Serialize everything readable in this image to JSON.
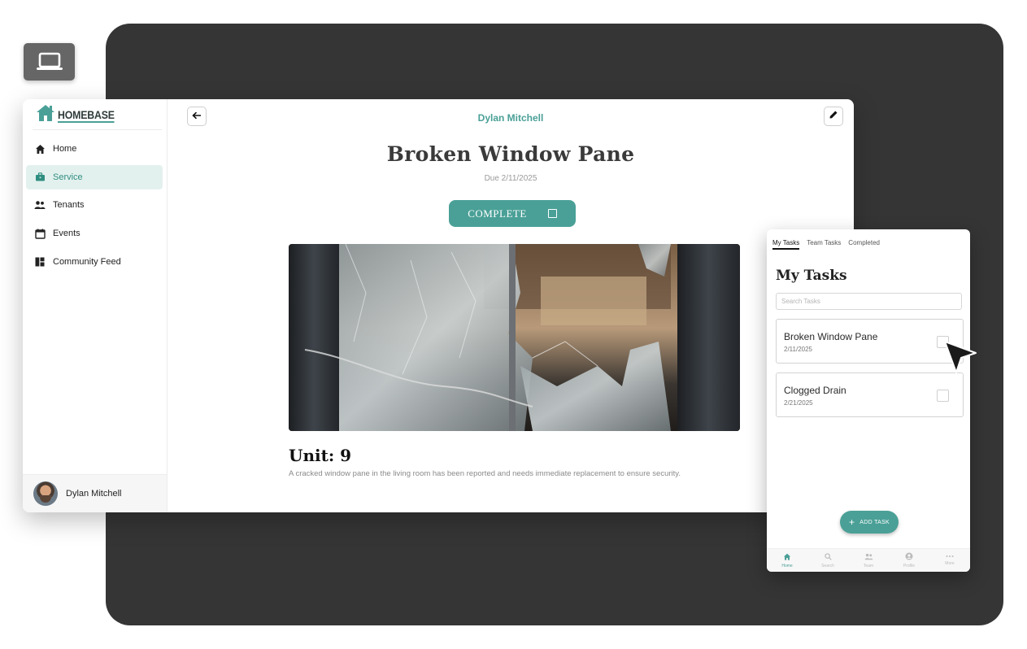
{
  "colors": {
    "accent": "#4aa097",
    "dark_panel": "#353535",
    "badge": "#666666"
  },
  "badges": {
    "desktop_icon": "laptop-icon",
    "mobile_icon": "phone-icon"
  },
  "desktop": {
    "brand": "HOMEBASE",
    "sidebar": {
      "items": [
        {
          "label": "Home",
          "icon": "home-icon"
        },
        {
          "label": "Service",
          "icon": "toolbox-icon",
          "active": true
        },
        {
          "label": "Tenants",
          "icon": "people-icon"
        },
        {
          "label": "Events",
          "icon": "calendar-icon"
        },
        {
          "label": "Community Feed",
          "icon": "dashboard-icon"
        }
      ],
      "user_name": "Dylan Mitchell"
    },
    "header": {
      "user_name": "Dylan Mitchell"
    },
    "task": {
      "title": "Broken Window Pane",
      "due": "Due 2/11/2025",
      "complete_label": "COMPLETE",
      "unit": "Unit: 9",
      "description": "A cracked window pane in the living room has been reported and needs immediate replacement to ensure security."
    }
  },
  "mobile": {
    "tabs": [
      "My Tasks",
      "Team Tasks",
      "Completed"
    ],
    "active_tab": "My Tasks",
    "title": "My Tasks",
    "search_placeholder": "Search Tasks",
    "tasks": [
      {
        "name": "Broken Window Pane",
        "date": "2/11/2025",
        "done": false
      },
      {
        "name": "Clogged Drain",
        "date": "2/21/2025",
        "done": false
      }
    ],
    "add_task_label": "ADD TASK",
    "bottom_nav": [
      {
        "label": "Home",
        "icon": "home-icon",
        "active": true
      },
      {
        "label": "Search",
        "icon": "search-icon"
      },
      {
        "label": "Team",
        "icon": "people-icon"
      },
      {
        "label": "Profile",
        "icon": "profile-icon"
      },
      {
        "label": "More",
        "icon": "more-icon"
      }
    ]
  }
}
